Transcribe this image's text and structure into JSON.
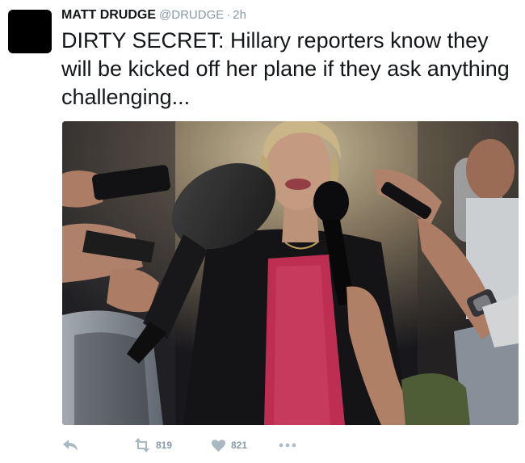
{
  "author": {
    "name": "MATT DRUDGE",
    "handle": "@DRUDGE",
    "separator": "·",
    "time": "2h"
  },
  "tweet": {
    "text": "DIRTY SECRET:  Hillary reporters know they will be kicked off her plane if they ask anything challenging..."
  },
  "media": {
    "type": "photo"
  },
  "actions": {
    "reply_icon": "reply-icon",
    "retweet_icon": "retweet-icon",
    "retweet_count": "819",
    "like_icon": "heart-icon",
    "like_count": "821",
    "more_icon": "more-icon"
  },
  "colors": {
    "text": "#14171a",
    "secondary": "#8899a6",
    "icon": "#aab8c2"
  }
}
